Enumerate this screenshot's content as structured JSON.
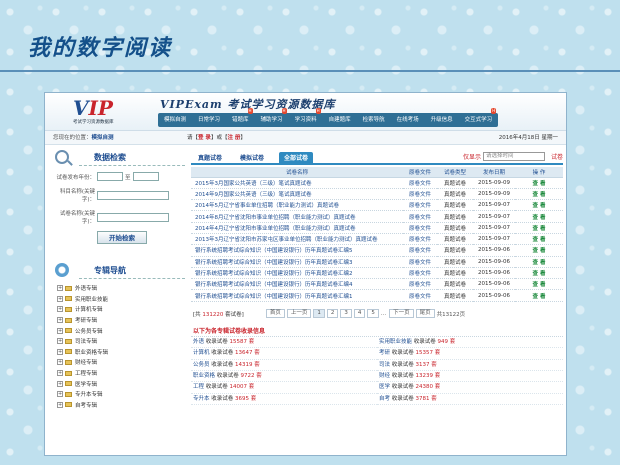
{
  "slide": {
    "title": "我的数字阅读"
  },
  "header": {
    "logo_mark": "VIP",
    "logo_sub": "考试学习资源数据库",
    "brand": "VIPExam 考试学习资源数据库",
    "nav": [
      {
        "label": "模拟自测",
        "hot": false
      },
      {
        "label": "日常学习",
        "hot": false
      },
      {
        "label": "错题库",
        "hot": true
      },
      {
        "label": "辅助学习",
        "hot": true
      },
      {
        "label": "学习资料",
        "hot": true
      },
      {
        "label": "自建题库",
        "hot": false
      },
      {
        "label": "检索导航",
        "hot": false
      },
      {
        "label": "在线考场",
        "hot": false
      },
      {
        "label": "升级信息",
        "hot": false
      },
      {
        "label": "交互式学习",
        "hot": true
      }
    ]
  },
  "locbar": {
    "prefix": "您现在的位置：",
    "location": "模拟自测",
    "login_pre": "请【",
    "login": "登 录",
    "login_mid": "】或【",
    "register": "注 册",
    "login_post": "】",
    "date": "2016年4月18日 星期一"
  },
  "search": {
    "title": "数据检索",
    "year_label": "试卷发布年份：",
    "year_to": "至",
    "subject_label": "科目名称(关键字)：",
    "paper_label": "试卷名称(关键字)：",
    "button": "开始检索"
  },
  "catnav": {
    "title": "专辑导航",
    "items": [
      "外语专辑",
      "实用职业技能",
      "计算机专辑",
      "考研专辑",
      "公务员专辑",
      "司法专辑",
      "职业资格专辑",
      "财经专辑",
      "工程专辑",
      "医学专辑",
      "专升本专辑",
      "自考专辑"
    ]
  },
  "tabs": {
    "items": [
      "真题试卷",
      "模拟试卷",
      "全部试卷"
    ],
    "active": 2,
    "only_show": "仅显示",
    "placeholder": "请选择时间",
    "paper": "试卷"
  },
  "table": {
    "headers": [
      "试卷名称",
      "原卷文件",
      "试卷类型",
      "发布日期",
      "操 作"
    ],
    "rows": [
      [
        "2015年3月国家公共英语（三级）笔试真题试卷",
        "原卷文件",
        "真题试卷",
        "2015-09-09",
        "查 看"
      ],
      [
        "2014年9月国家公共英语（三级）笔试真题试卷",
        "原卷文件",
        "真题试卷",
        "2015-09-09",
        "查 看"
      ],
      [
        "2014年5月辽宁省事业单位招聘（职业能力测试）真题试卷",
        "原卷文件",
        "真题试卷",
        "2015-09-07",
        "查 看"
      ],
      [
        "2014年8月辽宁省沈阳市事业单位招聘（职业能力测试）真题试卷",
        "原卷文件",
        "真题试卷",
        "2015-09-07",
        "查 看"
      ],
      [
        "2014年4月辽宁省沈阳市事业单位招聘（职业能力测试）真题试卷",
        "原卷文件",
        "真题试卷",
        "2015-09-07",
        "查 看"
      ],
      [
        "2013年3月辽宁省沈阳市苏家屯区事业单位招聘（职业能力测试）真题试卷",
        "原卷文件",
        "真题试卷",
        "2015-09-07",
        "查 看"
      ],
      [
        "银行系统招聘考试综合知识（中国建设银行）历年真题试卷汇编5",
        "原卷文件",
        "真题试卷",
        "2015-09-06",
        "查 看"
      ],
      [
        "银行系统招聘考试综合知识（中国建设银行）历年真题试卷汇编3",
        "原卷文件",
        "真题试卷",
        "2015-09-06",
        "查 看"
      ],
      [
        "银行系统招聘考试综合知识（中国建设银行）历年真题试卷汇编2",
        "原卷文件",
        "真题试卷",
        "2015-09-06",
        "查 看"
      ],
      [
        "银行系统招聘考试综合知识（中国建设银行）历年真题试卷汇编4",
        "原卷文件",
        "真题试卷",
        "2015-09-06",
        "查 看"
      ],
      [
        "银行系统招聘考试综合知识（中国建设银行）历年真题试卷汇编1",
        "原卷文件",
        "真题试卷",
        "2015-09-06",
        "查 看"
      ]
    ]
  },
  "pager": {
    "total_pre": "[共",
    "total": "131220",
    "total_post": "套试卷]",
    "first": "首页",
    "prev": "上一页",
    "pages": [
      "1",
      "2",
      "3",
      "4",
      "5"
    ],
    "ellipsis": "...",
    "next": "下一页",
    "last": "尾页",
    "pages_total": "共13122页"
  },
  "collection": {
    "title": "以下为各专辑试卷收录信息",
    "items": [
      {
        "name": "外语",
        "label": "收录试卷",
        "count": "15587",
        "unit": "套"
      },
      {
        "name": "实用职业技能",
        "label": "收录试卷",
        "count": "949",
        "unit": "套"
      },
      {
        "name": "计算机",
        "label": "收录试卷",
        "count": "13647",
        "unit": "套"
      },
      {
        "name": "考研",
        "label": "收录试卷",
        "count": "15357",
        "unit": "套"
      },
      {
        "name": "公务员",
        "label": "收录试卷",
        "count": "14319",
        "unit": "套"
      },
      {
        "name": "司法",
        "label": "收录试卷",
        "count": "3137",
        "unit": "套"
      },
      {
        "name": "职业资格",
        "label": "收录试卷",
        "count": "9722",
        "unit": "套"
      },
      {
        "name": "财经",
        "label": "收录试卷",
        "count": "13239",
        "unit": "套"
      },
      {
        "name": "工程",
        "label": "收录试卷",
        "count": "14007",
        "unit": "套"
      },
      {
        "name": "医学",
        "label": "收录试卷",
        "count": "24380",
        "unit": "套"
      },
      {
        "name": "专升本",
        "label": "收录试卷",
        "count": "3695",
        "unit": "套"
      },
      {
        "name": "自考",
        "label": "收录试卷",
        "count": "3781",
        "unit": "套"
      }
    ]
  }
}
